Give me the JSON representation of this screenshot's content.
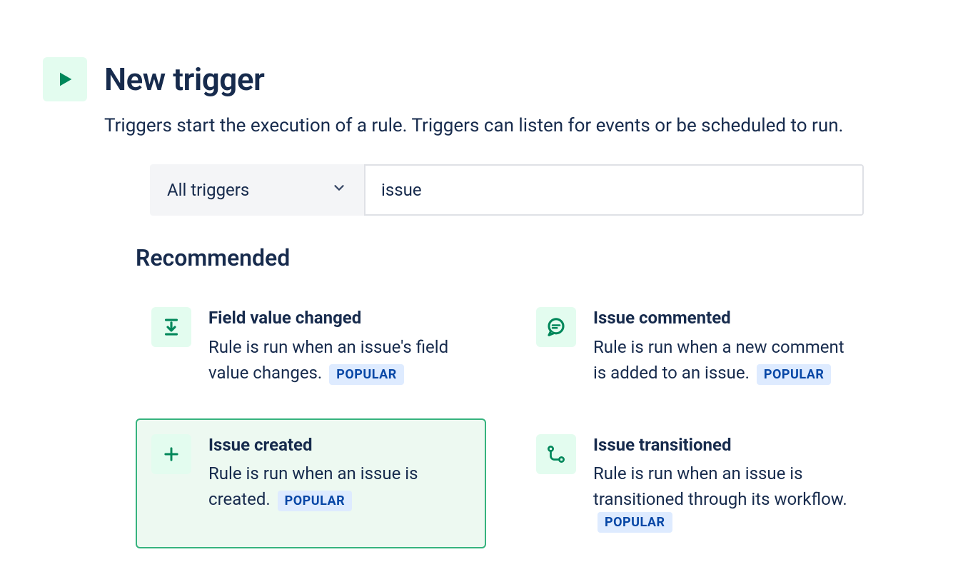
{
  "header": {
    "title": "New trigger",
    "description": "Triggers start the execution of a rule. Triggers can listen for events or be scheduled to run."
  },
  "filter": {
    "dropdown_label": "All triggers",
    "search_value": "issue"
  },
  "section": {
    "title": "Recommended"
  },
  "cards": [
    {
      "title": "Field value changed",
      "description": "Rule is run when an issue's field value changes.",
      "badge": "POPULAR",
      "selected": false,
      "icon": "download-arrow"
    },
    {
      "title": "Issue commented",
      "description": "Rule is run when a new comment is added to an issue.",
      "badge": "POPULAR",
      "selected": false,
      "icon": "comment"
    },
    {
      "title": "Issue created",
      "description": "Rule is run when an issue is created.",
      "badge": "POPULAR",
      "selected": true,
      "icon": "plus"
    },
    {
      "title": "Issue transitioned",
      "description": "Rule is run when an issue is transitioned through its workflow.",
      "badge": "POPULAR",
      "selected": false,
      "icon": "transition"
    }
  ],
  "colors": {
    "accent_green": "#00875A",
    "icon_green_bg": "#E3FCEF",
    "badge_bg": "#DEEBFF",
    "badge_text": "#0747A6",
    "text": "#172B4D",
    "selected_border": "#36B37E",
    "selected_bg": "#EDF9F1"
  }
}
